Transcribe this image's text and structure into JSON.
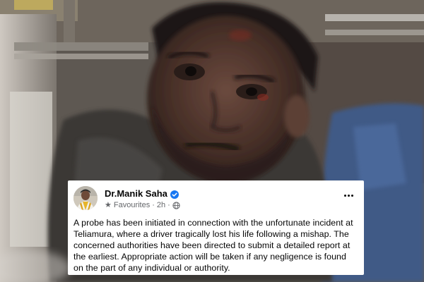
{
  "post": {
    "author": "Dr.Manik Saha",
    "audience": "Favourites",
    "time": "2h",
    "separator": "·",
    "body": "A probe has been initiated in connection with the unfortunate incident at Teliamura, where a driver tragically lost his life following a mishap. The concerned authorities have been directed to submit a detailed report at the earliest. Appropriate action will be taken if any negligence is found on the part of any individual or authority.",
    "icons": {
      "verified": "verified-badge-icon",
      "favourites": "star-icon",
      "privacy": "globe-icon",
      "more": "more-options-icon"
    }
  },
  "colors": {
    "card_bg": "#ffffff",
    "text_primary": "#050505",
    "text_secondary": "#65676b",
    "verified_blue": "#1877f2"
  }
}
